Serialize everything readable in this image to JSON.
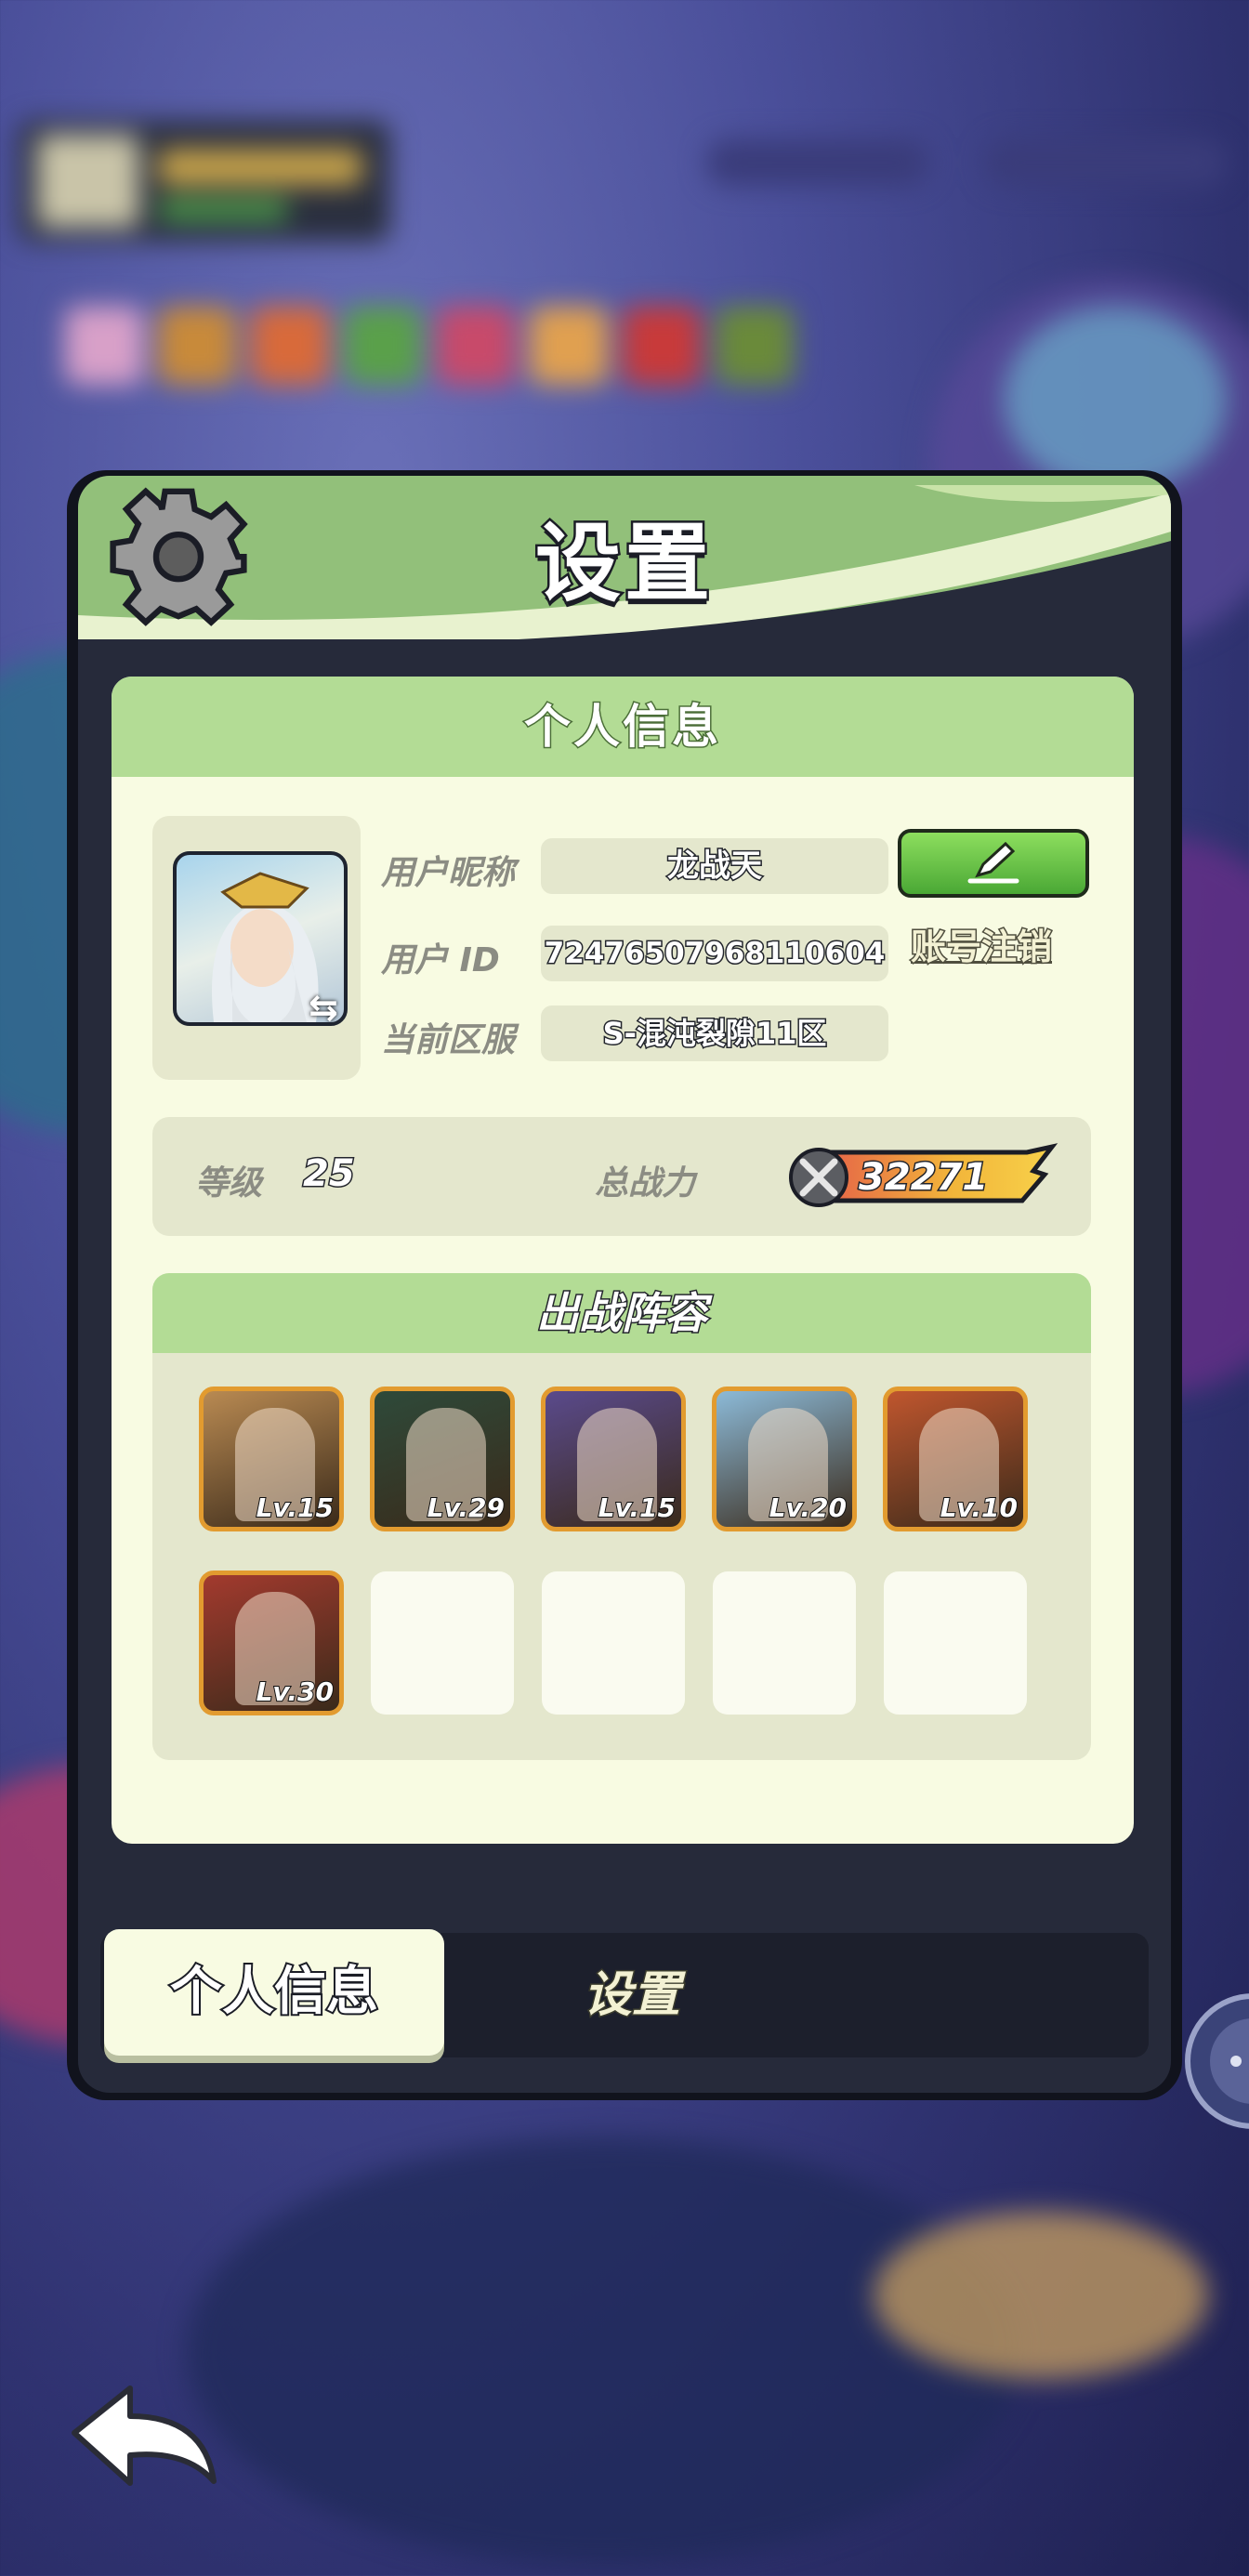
{
  "dialog": {
    "title": "设置",
    "section_title": "个人信息"
  },
  "profile": {
    "nickname_label": "用户昵称",
    "nickname_value": "龙战天",
    "id_label": "用户 ID",
    "id_value": "72476507968110604",
    "account_cancel_link": "账号注销",
    "server_label": "当前区服",
    "server_value": "S-混沌裂隙11区"
  },
  "stats": {
    "level_label": "等级",
    "level_value": "25",
    "power_label": "总战力",
    "power_value": "32271"
  },
  "lineup": {
    "title": "出战阵容",
    "heroes": [
      {
        "level": "Lv.15",
        "color": "#b98a52"
      },
      {
        "level": "Lv.29",
        "color": "#2e4a3a"
      },
      {
        "level": "Lv.15",
        "color": "#5a4a8c"
      },
      {
        "level": "Lv.20",
        "color": "#8cbad8"
      },
      {
        "level": "Lv.10",
        "color": "#c0562e"
      },
      {
        "level": "Lv.30",
        "color": "#a33a2e"
      }
    ]
  },
  "tabs": {
    "active": "个人信息",
    "inactive": "设置"
  },
  "icons": {
    "gear": "gear-icon",
    "edit": "pencil-icon",
    "back": "back-arrow-icon",
    "chat": "chat-bubble-icon",
    "swap": "swap-icon",
    "power": "crossed-swords-icon"
  }
}
